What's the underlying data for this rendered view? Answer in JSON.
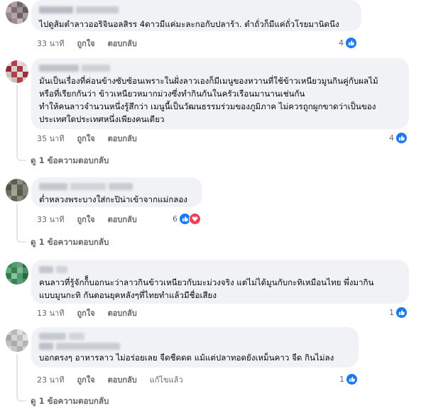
{
  "labels": {
    "like": "ถูกใจ",
    "reply": "ตอบกลับ",
    "edited": "แก้ไขแล้ว"
  },
  "colors": {
    "like": "#1877f2",
    "love": "#f33e58",
    "meta": "#65676b",
    "bubble": "#f0f2f5"
  },
  "comments": [
    {
      "text": "ไปดูส้มตำลาวออริจินอลสิรร 4ดาวมีแค่มะละกอกับปลาร้า. ตำถั่วก็มีแค่ถั่วโรยมานิดนึง",
      "time": "33 นาที",
      "reactions": {
        "count": "4",
        "icons": [
          "like-icon"
        ]
      }
    },
    {
      "text": "มันเป็นเรื่องที่ค่อนข้างซับซ้อนเพราะในฝั่งลาวเองก็มีเมนูของหวานที่ใช้ข้าวเหนียวมูนกินคู่กับผลไม้\nหรือที่เรียกกันว่า ข้าวเหนียวหมากม่วงซึ่งทำกินกันในครัวเรือนมานานเช่นกัน\nทำให้คนลาวจำนวนหนึ่งรู้สึกว่า เมนูนี้เป็นวัฒนธรรมร่วมของภูมิภาค ไม่ควรถูกผูกขาดว่าเป็นของ\nประเทศใดประเทศหนึ่งเพียงคนเดียว",
      "time": "35 นาที",
      "reactions": {
        "count": "4",
        "icons": [
          "like-icon"
        ]
      },
      "replies": "ดู 1 ข้อความตอบกลับ"
    },
    {
      "text": "ต่ำหลวงพระบางใส่กะปิน่าเข้าจากแม่กลอง",
      "time": "33 นาที",
      "reactions": {
        "count": "6",
        "icons": [
          "like-icon",
          "heart-icon"
        ]
      },
      "replies": "ดู 1 ข้อความตอบกลับ"
    },
    {
      "text": "คนลาวที่รู้จักก็็บอกนะว่าลาวกินข้าวเหนียวกับมะม่วงจริง แต่ไม่ได้มูนกับกะทิเหมือนไทย พึ่งมากิน\nแบบมูนกะทิ กันตอนยุคหลังๆที่ไทยทำแล้วมีชื่อเสียง",
      "time": "13 นาที",
      "reactions": {
        "count": "1",
        "icons": [
          "like-icon"
        ]
      }
    },
    {
      "text": "บอกตรงๆ อาหารลาว ไม่อร่อยเลย จืดชืดดด แม้แต่ปลาทอดยังเหม็นคาว จืด กินไม่ลง",
      "time": "23 นาที",
      "edited": true,
      "reactions": {
        "count": "1",
        "icons": [
          "like-icon"
        ]
      },
      "replies": "ดู 1 ข้อความตอบกลับ"
    }
  ]
}
